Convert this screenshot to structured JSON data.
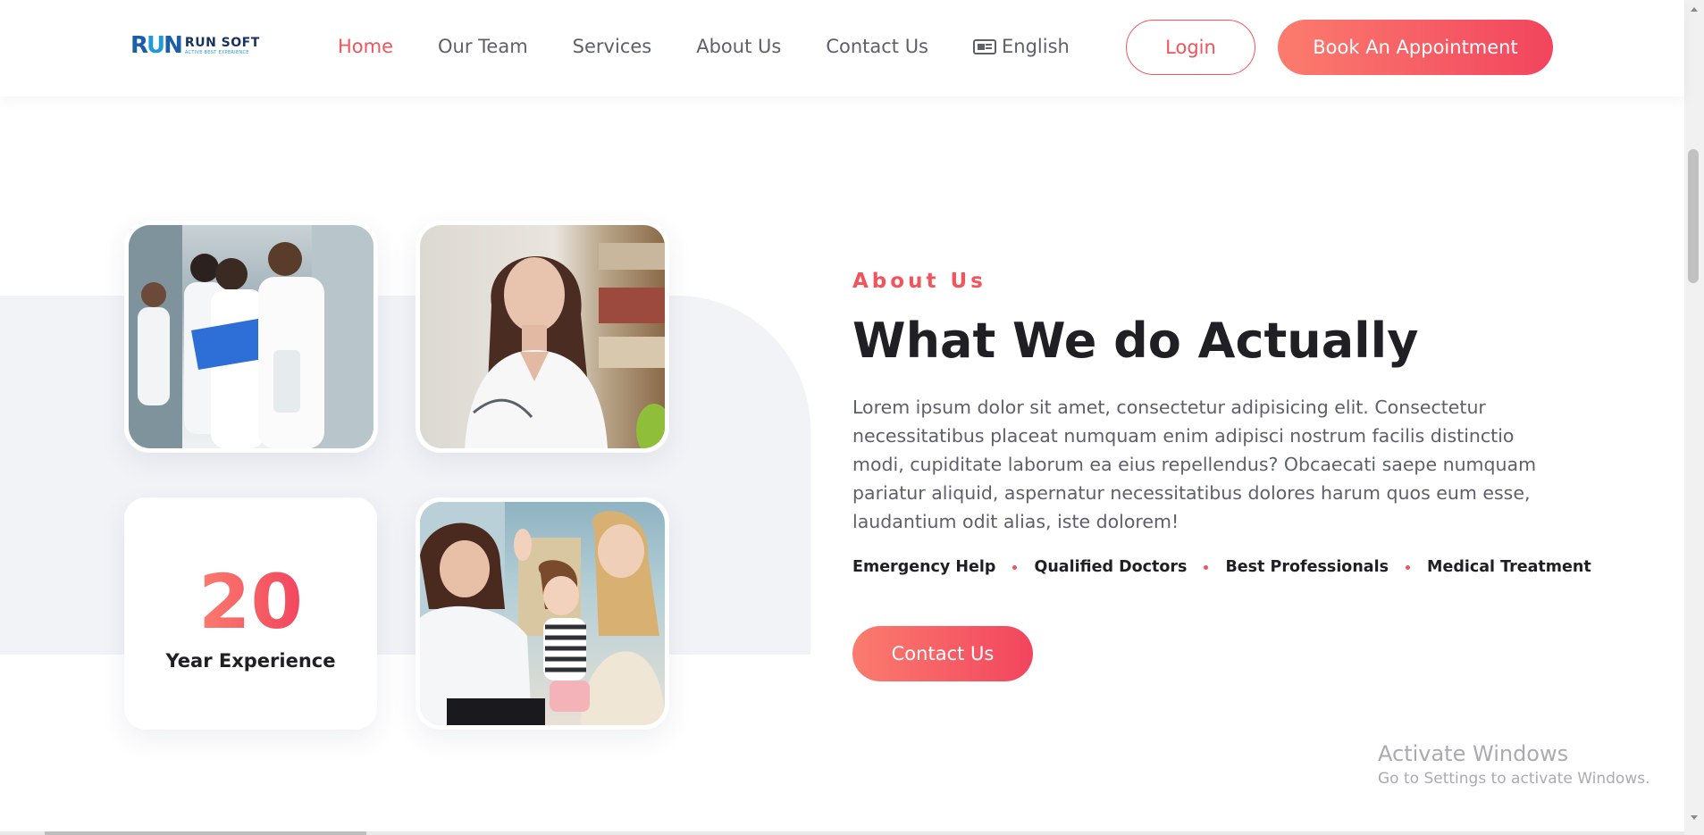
{
  "logo": {
    "mark": "RUN",
    "title": "RUN SOFT",
    "subtitle": "ACTIVE BEST EXPERIENCE"
  },
  "nav": {
    "items": [
      {
        "label": "Home",
        "active": true
      },
      {
        "label": "Our Team",
        "active": false
      },
      {
        "label": "Services",
        "active": false
      },
      {
        "label": "About Us",
        "active": false
      },
      {
        "label": "Contact Us",
        "active": false
      }
    ],
    "language": "English",
    "language_icon": "language-card-icon"
  },
  "header_buttons": {
    "login": "Login",
    "book": "Book An Appointment"
  },
  "experience": {
    "number": "20",
    "label": "Year Experience"
  },
  "about": {
    "eyebrow": "About Us",
    "title": "What We do Actually",
    "description": "Lorem ipsum dolor sit amet, consectetur adipisicing elit. Consectetur necessitatibus placeat numquam enim adipisci nostrum facilis distinctio modi, cupiditate laborum ea eius repellendus? Obcaecati saepe numquam pariatur aliquid, aspernatur necessitatibus dolores harum quos eum esse, laudantium odit alias, iste dolorem!",
    "features": [
      "Emergency Help",
      "Qualified Doctors",
      "Best Professionals",
      "Medical Treatment"
    ],
    "cta": "Contact Us"
  },
  "watermark": {
    "line1": "Activate Windows",
    "line2": "Go to Settings to activate Windows."
  },
  "colors": {
    "accent": "#f2545b",
    "gradient_start": "#fb7c6e",
    "gradient_end": "#f2455e",
    "heading": "#1f1f24",
    "body_text": "#5d6068",
    "panel_bg": "#f1f3f7"
  }
}
